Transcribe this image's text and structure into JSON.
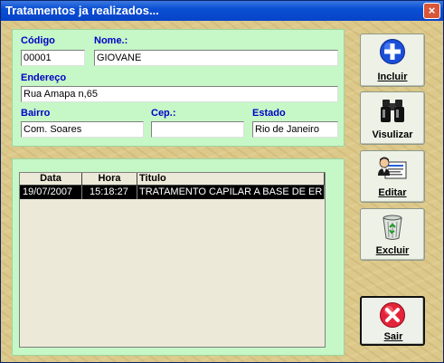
{
  "window": {
    "title": "Tratamentos ja realizados...",
    "close_glyph": "×"
  },
  "form": {
    "codigo_label": "Código",
    "codigo_value": "00001",
    "nome_label": "Nome.:",
    "nome_value": "GIOVANE",
    "endereco_label": "Endereço",
    "endereco_value": "Rua Amapa  n,65",
    "bairro_label": "Bairro",
    "bairro_value": "Com. Soares",
    "cep_label": "Cep.:",
    "cep_value": "",
    "estado_label": "Estado",
    "estado_value": "Rio de Janeiro"
  },
  "grid": {
    "columns": [
      "Data",
      "Hora",
      "Titulo"
    ],
    "rows": [
      {
        "data": "19/07/2007",
        "hora": "15:18:27",
        "titulo": "TRATAMENTO CAPILAR A BASE DE ER"
      }
    ]
  },
  "buttons": {
    "incluir": "Incluir",
    "visualizar": "Visulizar",
    "editar": "Editar",
    "excluir": "Excluir",
    "sair": "Sair"
  },
  "icons": {
    "incluir": "plus-circle-icon",
    "visualizar": "binoculars-icon",
    "editar": "person-card-icon",
    "excluir": "recycle-bin-icon",
    "sair": "x-circle-icon"
  },
  "colors": {
    "panel": "#c6f7c6",
    "label": "#0000c8",
    "titlebar": "#0a4fd4",
    "selected_row": "#000000"
  }
}
